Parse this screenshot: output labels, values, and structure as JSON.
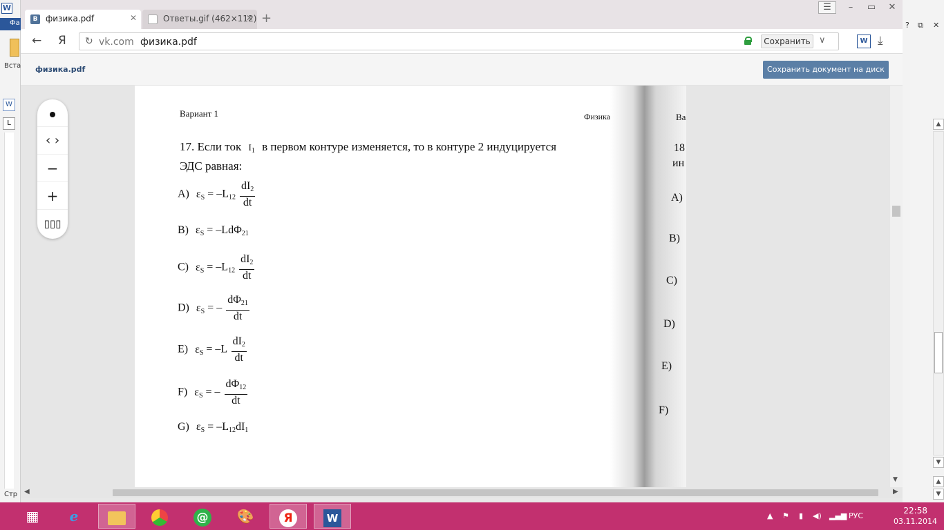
{
  "browser": {
    "tabs": [
      {
        "label": "физика.pdf",
        "icon": "vk-icon"
      },
      {
        "label": "Ответы.gif (462×112)",
        "icon": "document-icon"
      }
    ],
    "new_tab": "+",
    "address": {
      "host": "vk.com",
      "title": "физика.pdf"
    },
    "save_button": "Сохранить",
    "ya_button": "Я"
  },
  "vk": {
    "file_title": "физика.pdf",
    "save_to_disk": "Сохранить документ на диск"
  },
  "document": {
    "variant": "Вариант 1",
    "subject": "Физика",
    "question_line1_pre": "17. Если ток",
    "question_current": "I",
    "question_current_sub": "1",
    "question_line1_post": "в первом контуре изменяется, то в контуре 2 индуцируется",
    "question_line2": "ЭДС равная:",
    "options": {
      "A": {
        "label": "A)",
        "lhs": "ε",
        "lhs_sub": "S",
        "mid": "= –L",
        "mid_sub": "12",
        "num": "dI",
        "num_sub": "2",
        "den": "dt"
      },
      "B": {
        "label": "B)",
        "lhs": "ε",
        "lhs_sub": "S",
        "expr": "= –LdΦ",
        "expr_sub": "21"
      },
      "C": {
        "label": "C)",
        "lhs": "ε",
        "lhs_sub": "S",
        "mid": "= –L",
        "mid_sub": "12",
        "num": "dI",
        "num_sub": "2",
        "den": "dt"
      },
      "D": {
        "label": "D)",
        "lhs": "ε",
        "lhs_sub": "S",
        "mid": "= –",
        "num": "dΦ",
        "num_sub": "21",
        "den": "dt"
      },
      "E": {
        "label": "E)",
        "lhs": "ε",
        "lhs_sub": "S",
        "mid": "= –L",
        "num": "dI",
        "num_sub": "2",
        "den": "dt"
      },
      "F": {
        "label": "F)",
        "lhs": "ε",
        "lhs_sub": "S",
        "mid": "= –",
        "num": "dΦ",
        "num_sub": "12",
        "den": "dt"
      },
      "G": {
        "label": "G)",
        "lhs": "ε",
        "lhs_sub": "S",
        "expr": "= –L",
        "expr_sub": "12",
        "expr2": "dI",
        "expr2_sub": "1"
      }
    },
    "next_page": {
      "variant_fragment": "Ва",
      "q_fragment": "18",
      "q2_fragment": "ин",
      "a": "A)",
      "b": "B)",
      "c": "C)",
      "d": "D)",
      "e": "E)",
      "f": "F)"
    }
  },
  "word": {
    "tab_fragment": "Фа",
    "paste_fragment": "Вста",
    "status_fragment": "Стр"
  },
  "taskbar": {
    "lang": "РУС",
    "time": "22:58",
    "date": "03.11.2014"
  },
  "colors": {
    "accent_pink": "#d63f8b",
    "vk_button": "#5b7fa6",
    "vk_title": "#2b4a73"
  }
}
